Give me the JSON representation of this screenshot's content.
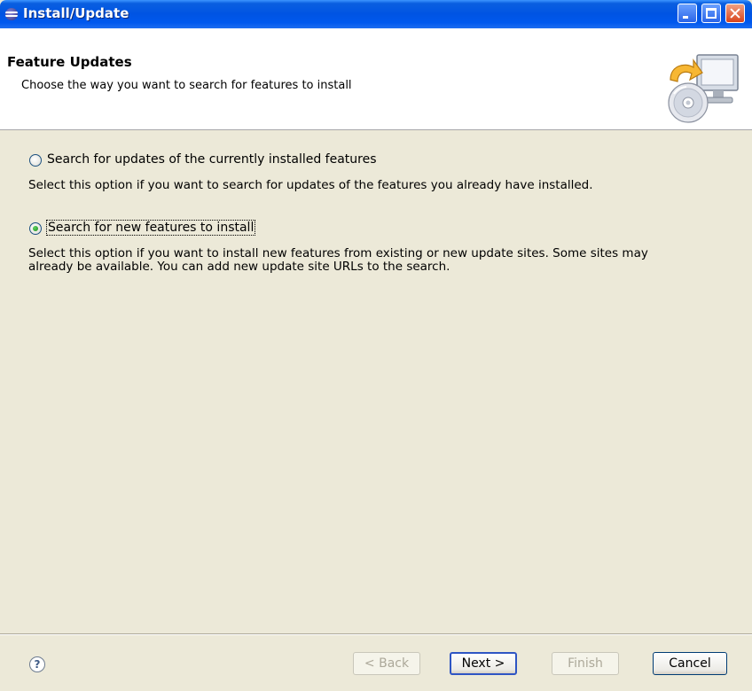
{
  "window": {
    "title": "Install/Update"
  },
  "header": {
    "title": "Feature Updates",
    "description": "Choose the way you want to search for features to install"
  },
  "options": [
    {
      "label": "Search for updates of the currently installed features",
      "description": "Select this option if you want to search for updates of the features you already have installed.",
      "selected": false
    },
    {
      "label": "Search for new features to install",
      "description_line1": "Select this option if you want to install new features from existing or new update sites. Some sites may",
      "description_line2": "already be available. You can add new update site URLs to the search.",
      "selected": true
    }
  ],
  "buttons": {
    "help": "?",
    "back": "< Back",
    "next": "Next >",
    "finish": "Finish",
    "cancel": "Cancel"
  },
  "colors": {
    "titlebar": "#0054e3",
    "dialog_bg": "#ece9d8",
    "header_bg": "#ffffff",
    "default_button_border": "#2e55c4"
  },
  "icons": {
    "title": "eclipse-icon",
    "header": "install-cd-monitor-icon",
    "help": "help-icon"
  }
}
